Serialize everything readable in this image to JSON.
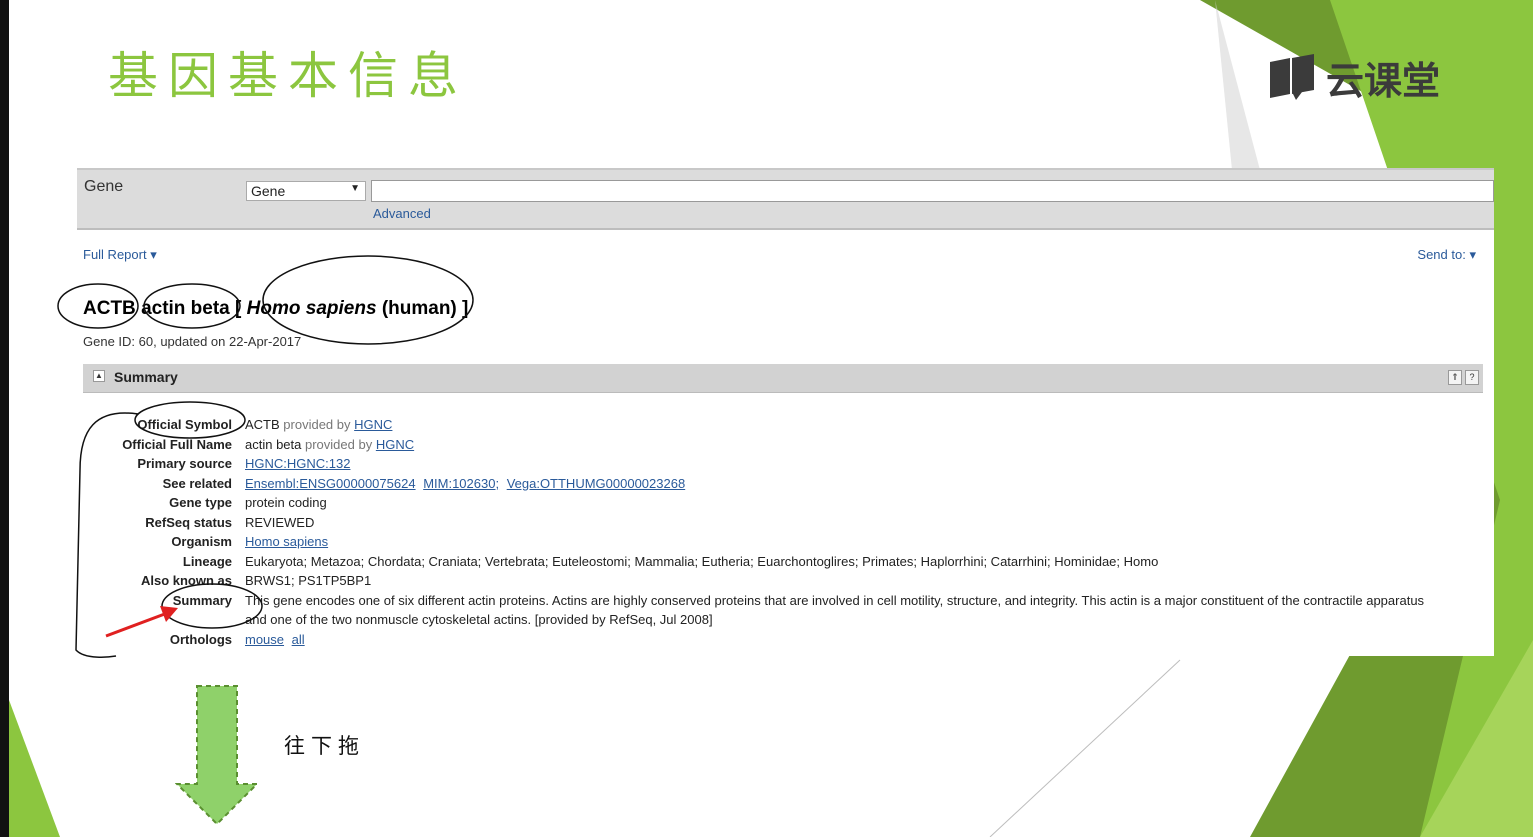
{
  "slide": {
    "title": "基因基本信息",
    "logo_text": "云课堂",
    "drag_hint": "往下拖",
    "accent_color": "#8cc63f",
    "arrow_color": "#8fd16a"
  },
  "search": {
    "db_label": "Gene",
    "db_selected": "Gene",
    "query_value": "",
    "advanced_label": "Advanced"
  },
  "toolbar": {
    "full_report": "Full Report",
    "send_to": "Send to:"
  },
  "gene": {
    "symbol": "ACTB",
    "name": "actin beta",
    "bracket_open": "[",
    "organism": "Homo sapiens",
    "organism_common": "(human)",
    "bracket_close": "]",
    "meta": "Gene ID: 60, updated on 22-Apr-2017"
  },
  "summary_section": {
    "label": "Summary",
    "rows": {
      "official_symbol": {
        "key": "Official Symbol",
        "value": "ACTB",
        "provided": "provided by",
        "link": "HGNC"
      },
      "official_full_name": {
        "key": "Official Full Name",
        "value": "actin beta",
        "provided": "provided by",
        "link": "HGNC"
      },
      "primary_source": {
        "key": "Primary source",
        "link": "HGNC:HGNC:132"
      },
      "see_related": {
        "key": "See related",
        "links": [
          "Ensembl:ENSG00000075624",
          "MIM:102630;",
          "Vega:OTTHUMG00000023268"
        ]
      },
      "gene_type": {
        "key": "Gene type",
        "value": "protein coding"
      },
      "refseq_status": {
        "key": "RefSeq status",
        "value": "REVIEWED"
      },
      "organism": {
        "key": "Organism",
        "link": "Homo sapiens"
      },
      "lineage": {
        "key": "Lineage",
        "value": "Eukaryota; Metazoa; Chordata; Craniata; Vertebrata; Euteleostomi; Mammalia; Eutheria; Euarchontoglires; Primates; Haplorrhini; Catarrhini; Hominidae; Homo"
      },
      "also_known_as": {
        "key": "Also known as",
        "value": "BRWS1; PS1TP5BP1"
      },
      "summary": {
        "key": "Summary",
        "value": "This gene encodes one of six different actin proteins. Actins are highly conserved proteins that are involved in cell motility, structure, and integrity. This actin is a major constituent of the contractile apparatus and one of the two nonmuscle cytoskeletal actins. [provided by RefSeq, Jul 2008]"
      },
      "orthologs": {
        "key": "Orthologs",
        "links": [
          "mouse",
          "all"
        ]
      }
    }
  }
}
